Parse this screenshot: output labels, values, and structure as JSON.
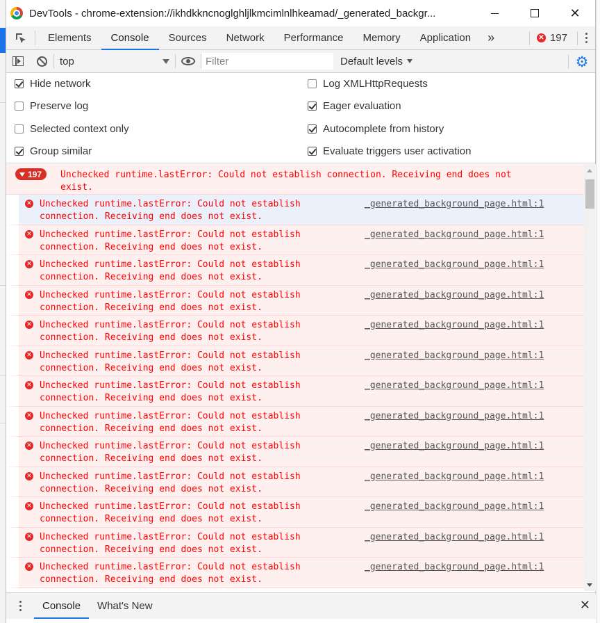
{
  "window": {
    "title": "DevTools - chrome-extension://ikhdkkncnoglghljlkmcimlnlhkeamad/_generated_backgr...",
    "icon": "chrome-logo-icon"
  },
  "tabs": {
    "items": [
      "Elements",
      "Console",
      "Sources",
      "Network",
      "Performance",
      "Memory",
      "Application"
    ],
    "active": "Console",
    "more": "»",
    "error_count": "197"
  },
  "toolbar": {
    "context": "top",
    "filter_placeholder": "Filter",
    "levels": "Default levels"
  },
  "settings": {
    "left": [
      {
        "label": "Hide network",
        "checked": true
      },
      {
        "label": "Preserve log",
        "checked": false
      },
      {
        "label": "Selected context only",
        "checked": false
      },
      {
        "label": "Group similar",
        "checked": true
      }
    ],
    "right": [
      {
        "label": "Log XMLHttpRequests",
        "checked": false
      },
      {
        "label": "Eager evaluation",
        "checked": true
      },
      {
        "label": "Autocomplete from history",
        "checked": true
      },
      {
        "label": "Evaluate triggers user activation",
        "checked": true
      }
    ]
  },
  "group": {
    "count": "197",
    "line1": "Unchecked runtime.lastError: Could not establish connection. Receiving end does not",
    "line2": "exist."
  },
  "message": {
    "line1": "Unchecked runtime.lastError: Could not establish",
    "line2": "connection. Receiving end does not exist.",
    "source": "_generated_background_page.html:1",
    "visible_rows": 13
  },
  "drawer": {
    "tabs": [
      "Console",
      "What's New"
    ],
    "active": "Console"
  },
  "colors": {
    "accent": "#1a73e8",
    "error_text": "#ff0000",
    "error_bg": "#fff0f0",
    "error_badge": "#d93025"
  }
}
